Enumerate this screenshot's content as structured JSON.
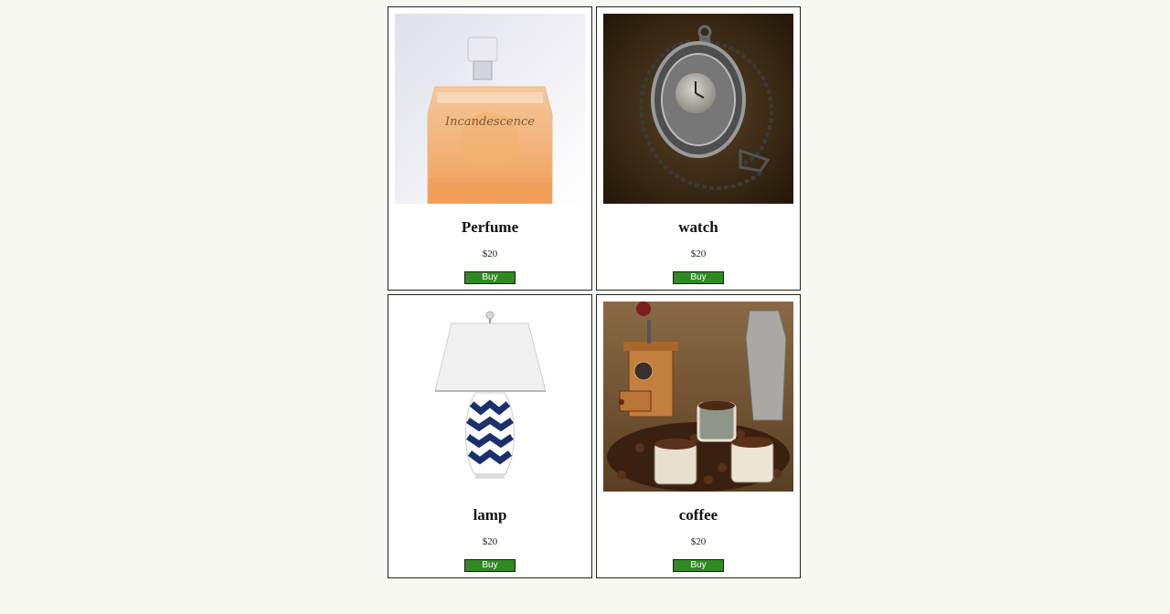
{
  "products": [
    {
      "name": "Perfume",
      "price": "$20",
      "buy_label": "Buy",
      "image": "perfume-bottle-image"
    },
    {
      "name": "watch",
      "price": "$20",
      "buy_label": "Buy",
      "image": "pocket-watch-image"
    },
    {
      "name": "lamp",
      "price": "$20",
      "buy_label": "Buy",
      "image": "table-lamp-image"
    },
    {
      "name": "coffee",
      "price": "$20",
      "buy_label": "Buy",
      "image": "coffee-set-image"
    }
  ],
  "colors": {
    "page_background": "#f8f8f3",
    "card_background": "#ffffff",
    "card_border": "#222222",
    "buy_button": "#2f8a22"
  }
}
